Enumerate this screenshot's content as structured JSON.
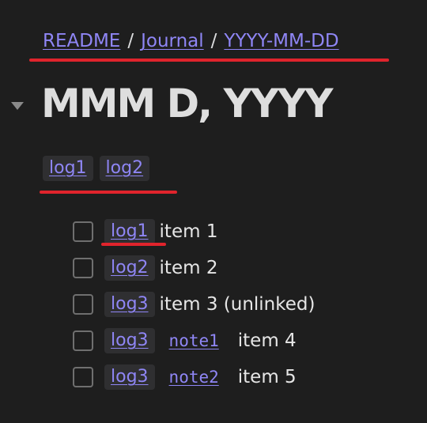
{
  "breadcrumb": {
    "items": [
      "README",
      "Journal",
      "YYYY-MM-DD"
    ],
    "separator": "/"
  },
  "page": {
    "title": "MMM D, YYYY"
  },
  "tags": [
    "log1",
    "log2"
  ],
  "tasks": [
    {
      "checked": false,
      "tag": "log1",
      "note": "",
      "text": "item 1"
    },
    {
      "checked": false,
      "tag": "log2",
      "note": "",
      "text": "item 2"
    },
    {
      "checked": false,
      "tag": "log3",
      "note": "",
      "text": "item 3 (unlinked)"
    },
    {
      "checked": false,
      "tag": "log3",
      "note": "note1",
      "text": "item 4"
    },
    {
      "checked": false,
      "tag": "log3",
      "note": "note2",
      "text": "item 5"
    }
  ],
  "colors": {
    "background": "#1e1e1e",
    "link": "#8f86f5",
    "tag_background": "#2f2f31",
    "annotation_red": "#e0242c"
  },
  "icons": {
    "collapse": "collapse-arrow-icon",
    "checkbox": "checkbox-icon"
  }
}
